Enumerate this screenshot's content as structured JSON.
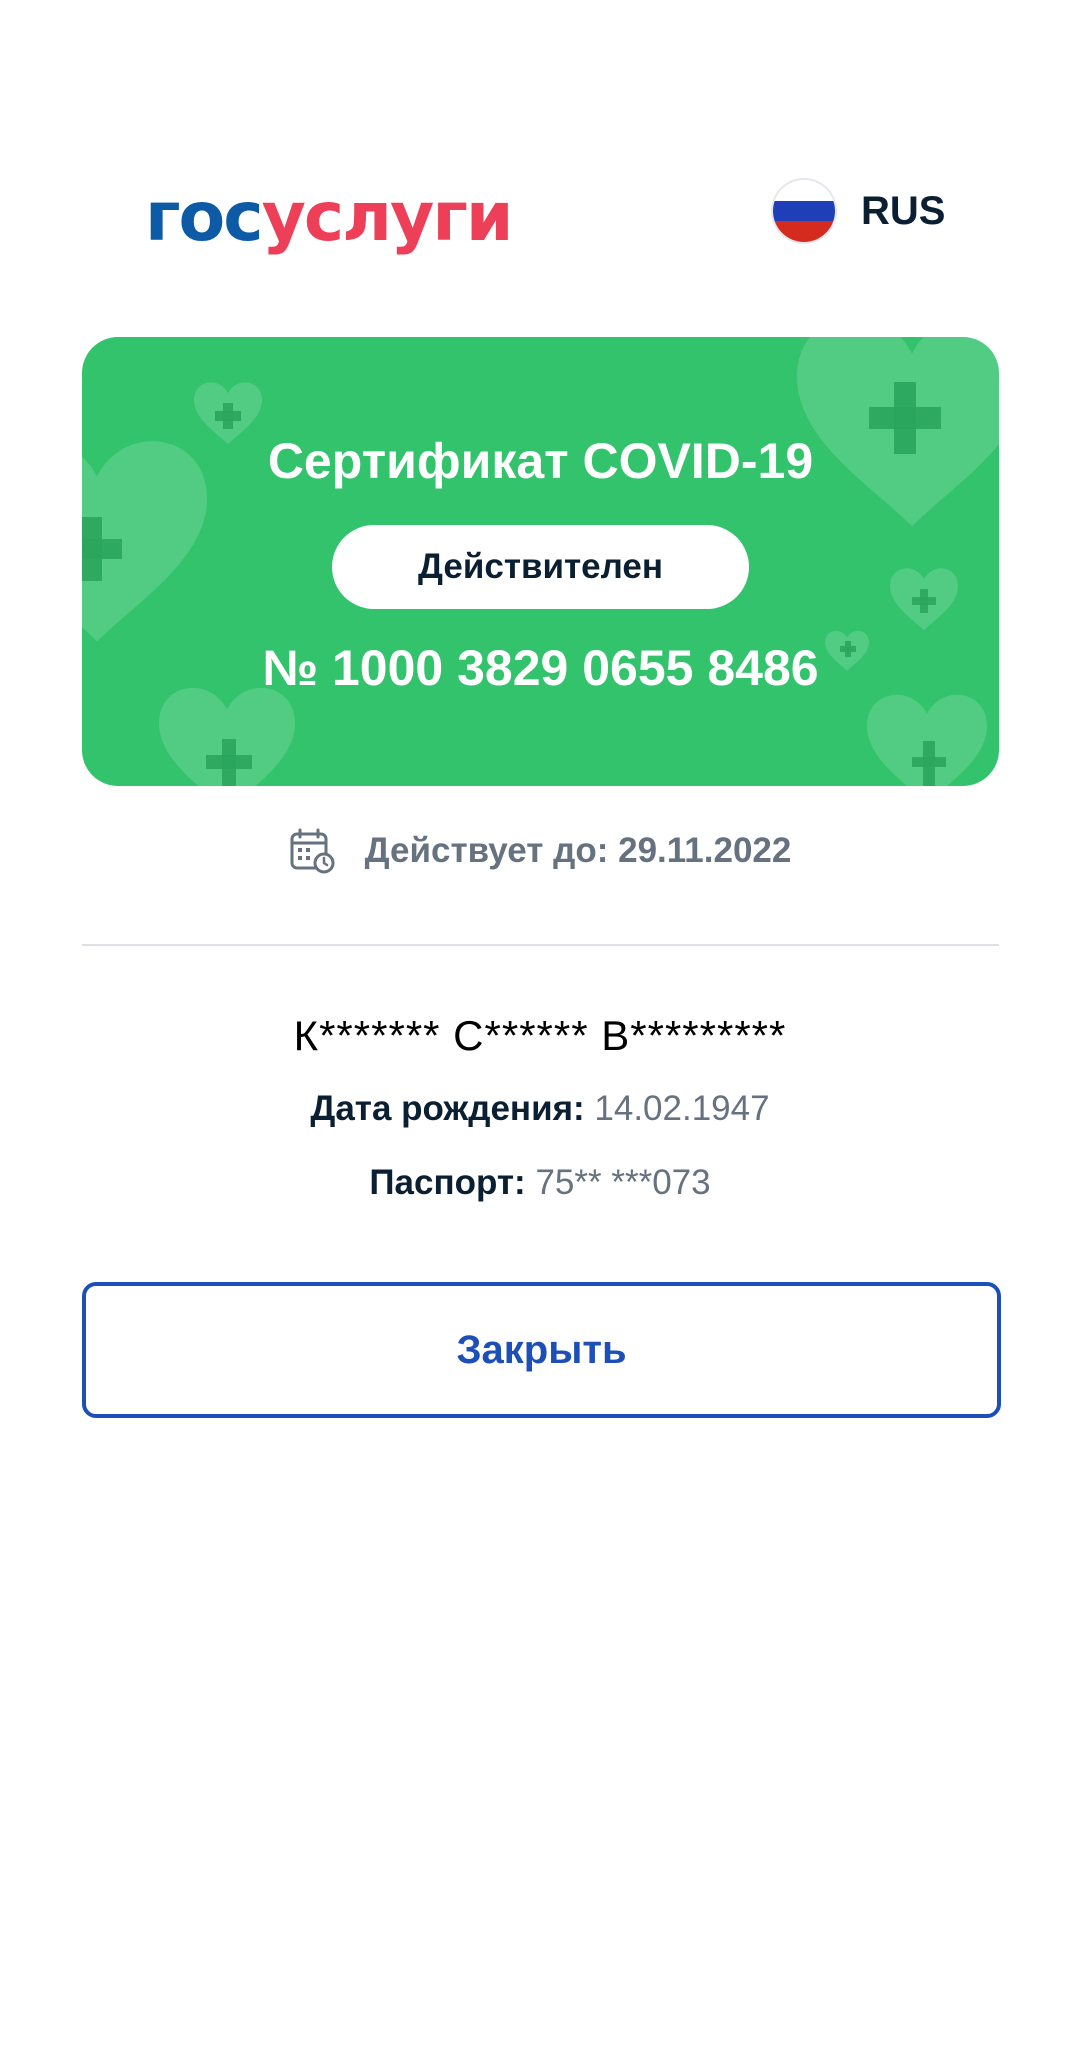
{
  "header": {
    "logo_part1": "гос",
    "logo_part2": "услуги",
    "language": "RUS",
    "flag_icon": "russia-flag-icon"
  },
  "certificate": {
    "title": "Сертификат COVID-19",
    "status": "Действителен",
    "number": "№ 1000 3829 0655 8486",
    "card_color": "#32c36c"
  },
  "validity": {
    "icon": "calendar-clock-icon",
    "text": "Действует до: 29.11.2022"
  },
  "person": {
    "name": "К******* С****** В*********",
    "dob_label": "Дата рождения:",
    "dob_value": "14.02.1947",
    "passport_label": "Паспорт:",
    "passport_value": "75** ***073"
  },
  "actions": {
    "close_label": "Закрыть",
    "accent_color": "#1d4fb8"
  }
}
